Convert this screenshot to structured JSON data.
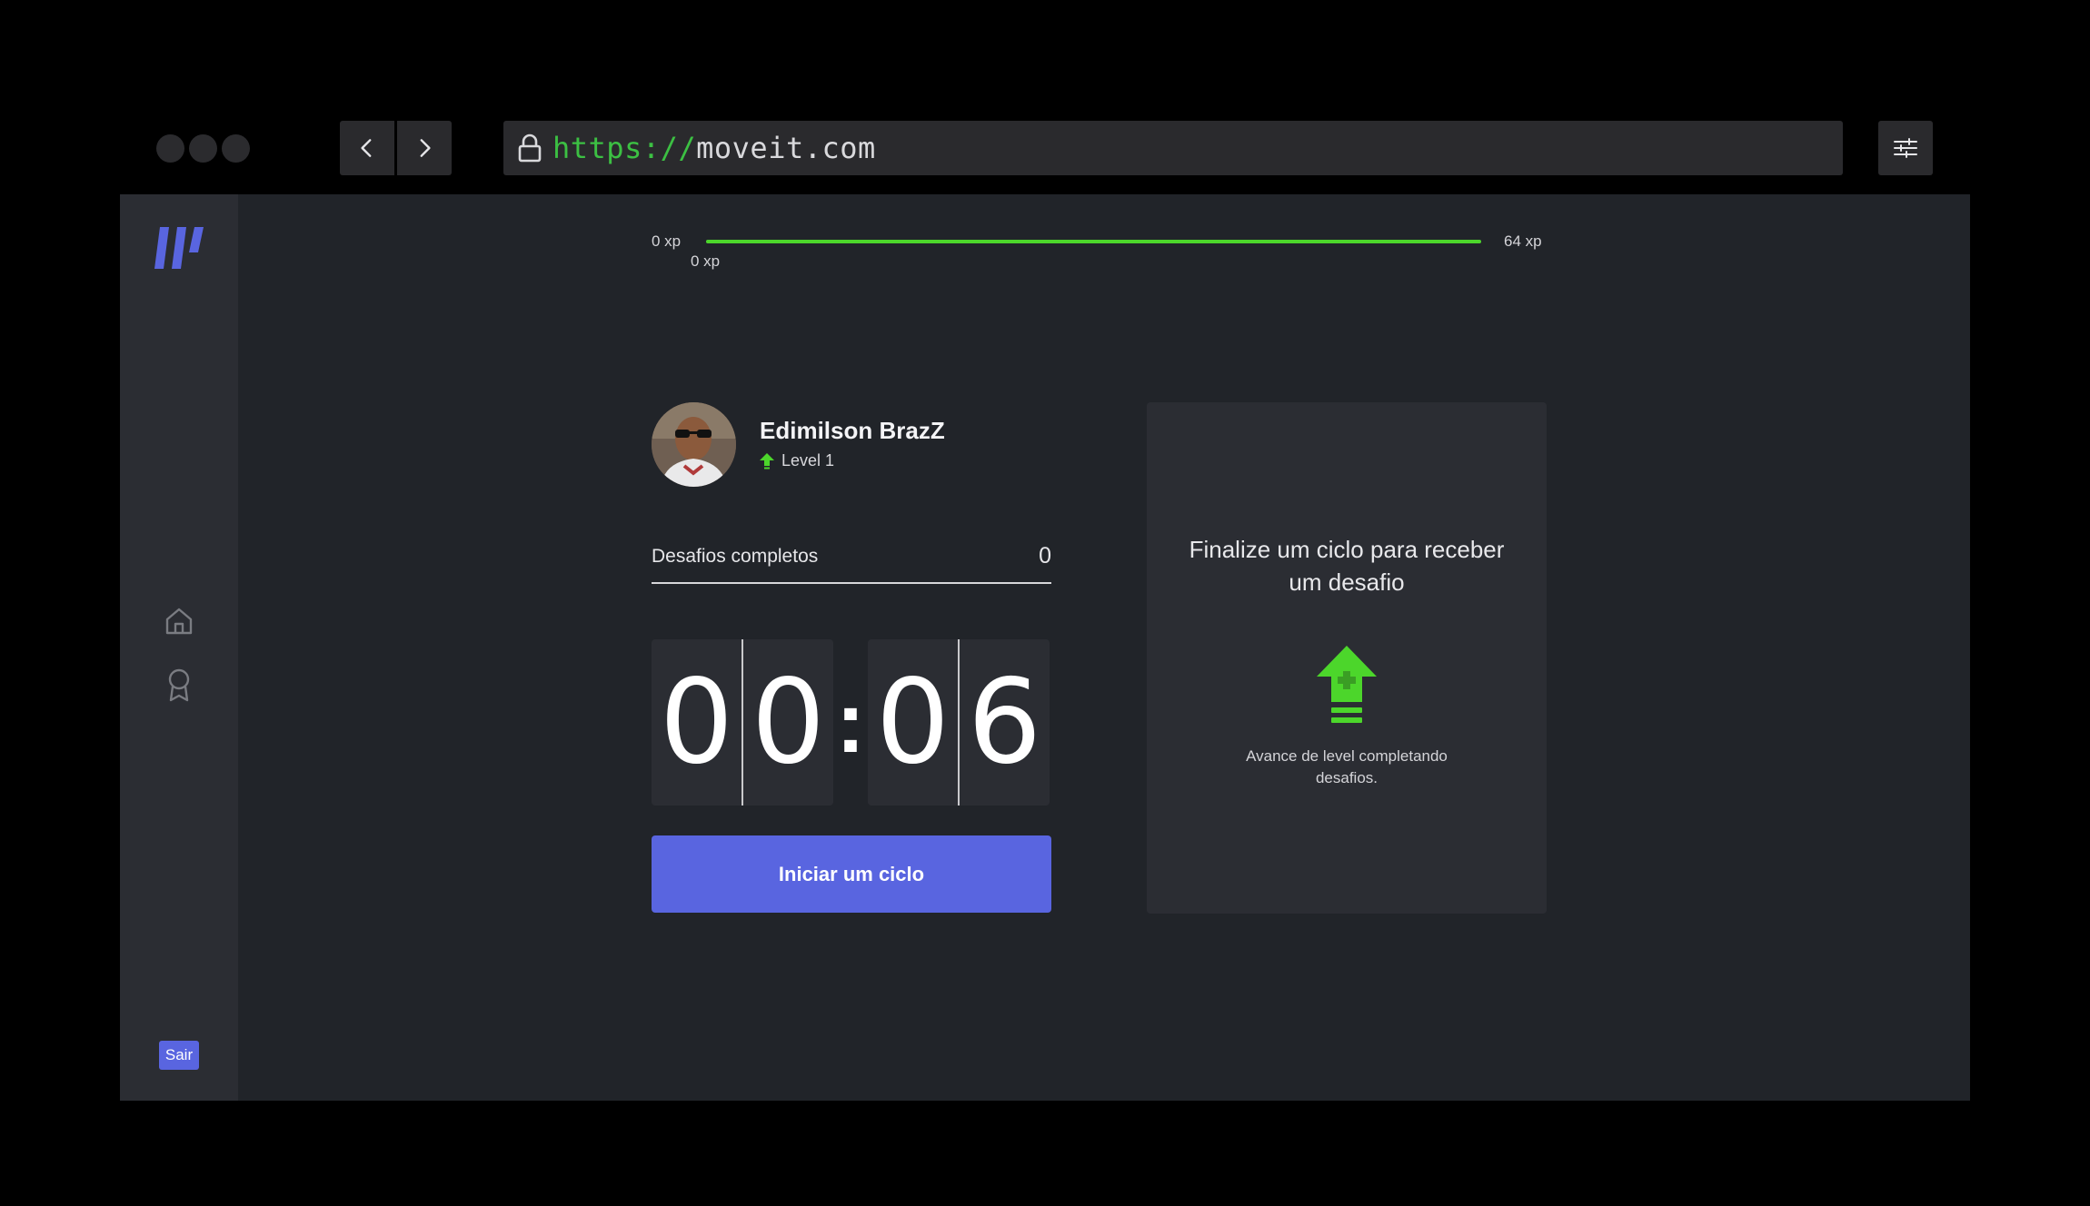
{
  "browser": {
    "url_scheme": "https://",
    "url_host": "moveit.com",
    "icons": {
      "back": "chevron-left-icon",
      "forward": "chevron-right-icon",
      "lock": "lock-icon",
      "settings": "sliders-icon"
    }
  },
  "sidebar": {
    "logo": "moveit-logo",
    "items": [
      {
        "icon": "home-icon"
      },
      {
        "icon": "award-icon"
      }
    ],
    "logout_label": "Sair"
  },
  "xp": {
    "start_label": "0 xp",
    "end_label": "64 xp",
    "current_label": "0 xp",
    "progress": 1.0
  },
  "profile": {
    "name": "Edimilson BrazZ",
    "level_label": "Level 1"
  },
  "challenges": {
    "label": "Desafios completos",
    "count": "0"
  },
  "countdown": {
    "minute_left": "0",
    "minute_right": "0",
    "colon": ":",
    "second_left": "0",
    "second_right": "6"
  },
  "start_button_label": "Iniciar um ciclo",
  "challenge_box": {
    "title": "Finalize um ciclo para receber um desafio",
    "description": "Avance de level completando desafios.",
    "icon": "level-up-icon"
  },
  "colors": {
    "accent": "#5965e0",
    "green": "#4cd62b",
    "background": "#212429",
    "panel": "#2b2d33"
  }
}
